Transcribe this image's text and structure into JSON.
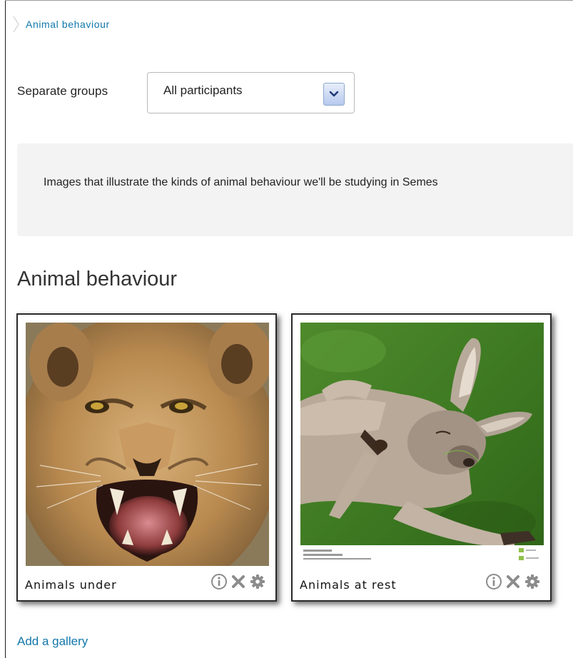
{
  "breadcrumb": {
    "label": "Animal behaviour"
  },
  "groups": {
    "label": "Separate groups",
    "selected": "All participants"
  },
  "intro": {
    "text": "Images that illustrate the kinds of animal behaviour we'll be studying in Semes"
  },
  "section": {
    "title": "Animal behaviour"
  },
  "galleries": [
    {
      "caption": "Animals under",
      "image": "snarling-lioness-photo"
    },
    {
      "caption": "Animals at rest",
      "image": "sleeping-kangaroo-photo"
    }
  ],
  "actions": [
    "info-icon",
    "delete-icon",
    "settings-icon"
  ],
  "add_gallery": {
    "label": "Add a gallery"
  },
  "colors": {
    "link": "#1177aa",
    "intro_background": "#f3f3f3",
    "card_border": "#2a2a2a",
    "icon_gray": "#8c8c8c"
  }
}
